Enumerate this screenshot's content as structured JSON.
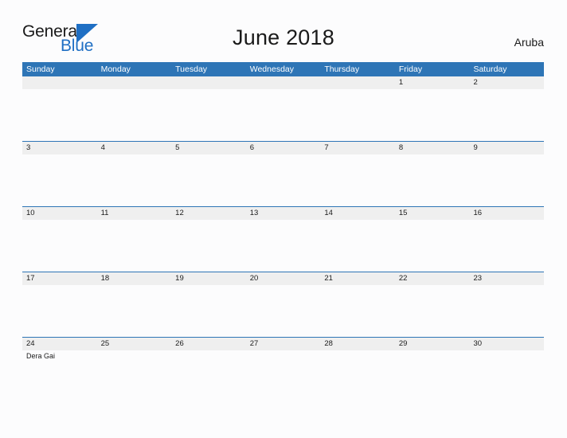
{
  "brand": {
    "name_part1": "General",
    "name_part2": "Blue",
    "flag_color": "#1F6FC4"
  },
  "header": {
    "title": "June 2018",
    "country": "Aruba",
    "accent_color": "#2E75B6",
    "band_color": "#EFEFEF"
  },
  "weekdays": [
    "Sunday",
    "Monday",
    "Tuesday",
    "Wednesday",
    "Thursday",
    "Friday",
    "Saturday"
  ],
  "weeks": [
    {
      "dates": [
        "",
        "",
        "",
        "",
        "",
        "1",
        "2"
      ],
      "events": [
        "",
        "",
        "",
        "",
        "",
        "",
        ""
      ]
    },
    {
      "dates": [
        "3",
        "4",
        "5",
        "6",
        "7",
        "8",
        "9"
      ],
      "events": [
        "",
        "",
        "",
        "",
        "",
        "",
        ""
      ]
    },
    {
      "dates": [
        "10",
        "11",
        "12",
        "13",
        "14",
        "15",
        "16"
      ],
      "events": [
        "",
        "",
        "",
        "",
        "",
        "",
        ""
      ]
    },
    {
      "dates": [
        "17",
        "18",
        "19",
        "20",
        "21",
        "22",
        "23"
      ],
      "events": [
        "",
        "",
        "",
        "",
        "",
        "",
        ""
      ]
    },
    {
      "dates": [
        "24",
        "25",
        "26",
        "27",
        "28",
        "29",
        "30"
      ],
      "events": [
        "Dera Gai",
        "",
        "",
        "",
        "",
        "",
        ""
      ]
    }
  ]
}
